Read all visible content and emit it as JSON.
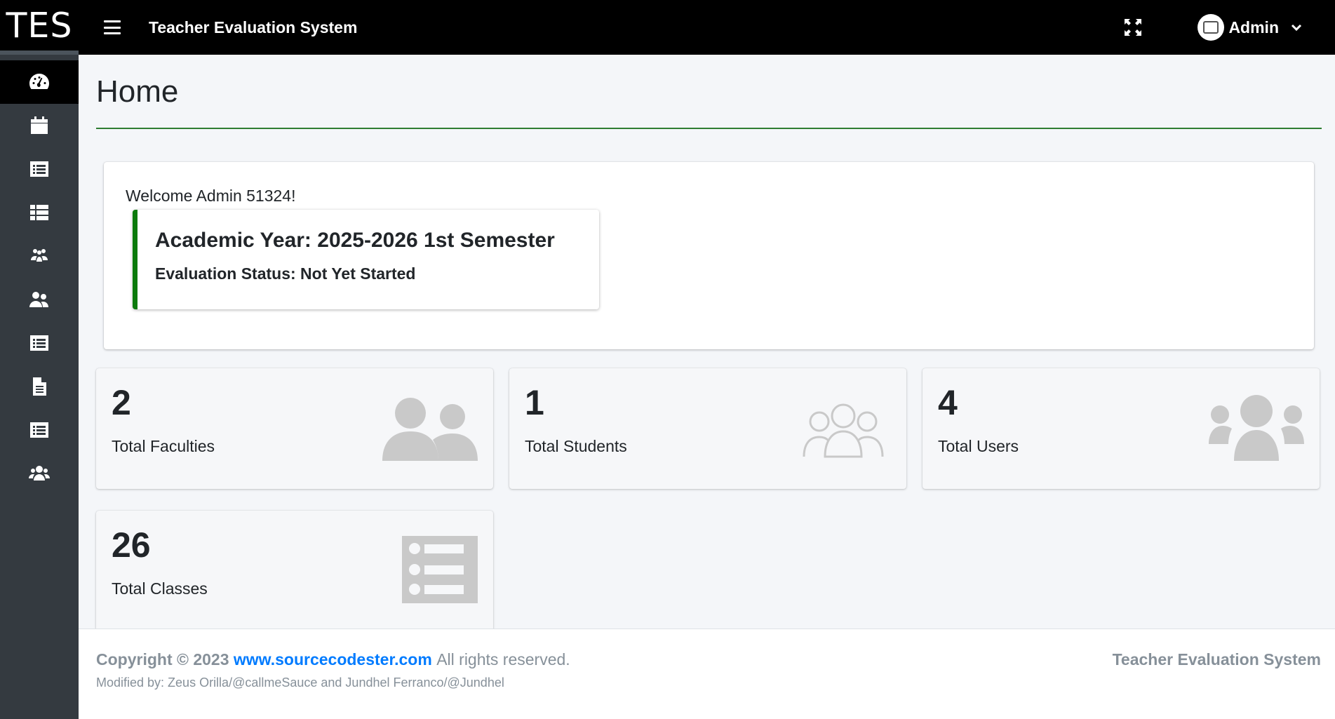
{
  "brand": "TES",
  "app_title": "Teacher Evaluation System",
  "user": {
    "name": "Admin"
  },
  "sidebar": {
    "items": [
      {
        "icon": "dashboard-icon"
      },
      {
        "icon": "calendar-icon"
      },
      {
        "icon": "list-icon"
      },
      {
        "icon": "table-list-icon"
      },
      {
        "icon": "students-icon"
      },
      {
        "icon": "users-icon"
      },
      {
        "icon": "list-icon"
      },
      {
        "icon": "document-icon"
      },
      {
        "icon": "list-icon"
      },
      {
        "icon": "user-group-icon"
      }
    ]
  },
  "page": {
    "title": "Home",
    "welcome": "Welcome Admin 51324!",
    "academic_year": "Academic Year: 2025-2026 1st Semester",
    "evaluation_status": "Evaluation Status: Not Yet Started"
  },
  "stats": [
    {
      "value": "2",
      "label": "Total Faculties",
      "icon": "faculty-users-icon"
    },
    {
      "value": "1",
      "label": "Total Students",
      "icon": "students-outline-icon"
    },
    {
      "value": "4",
      "label": "Total Users",
      "icon": "user-group-icon"
    },
    {
      "value": "26",
      "label": "Total Classes",
      "icon": "list-alt-icon"
    }
  ],
  "footer": {
    "copyright": "Copyright © 2023",
    "link": "www.sourcecodester.com",
    "rights": "All rights reserved.",
    "modified": "Modified by: Zeus Orilla/@callmeSauce and Jundhel Ferranco/@Jundhel",
    "right_text": "Teacher Evaluation System"
  },
  "colors": {
    "accent_green": "#0b7a0b",
    "link_blue": "#007bff",
    "sidebar_bg": "#343a40",
    "topbar_bg": "#000000"
  }
}
